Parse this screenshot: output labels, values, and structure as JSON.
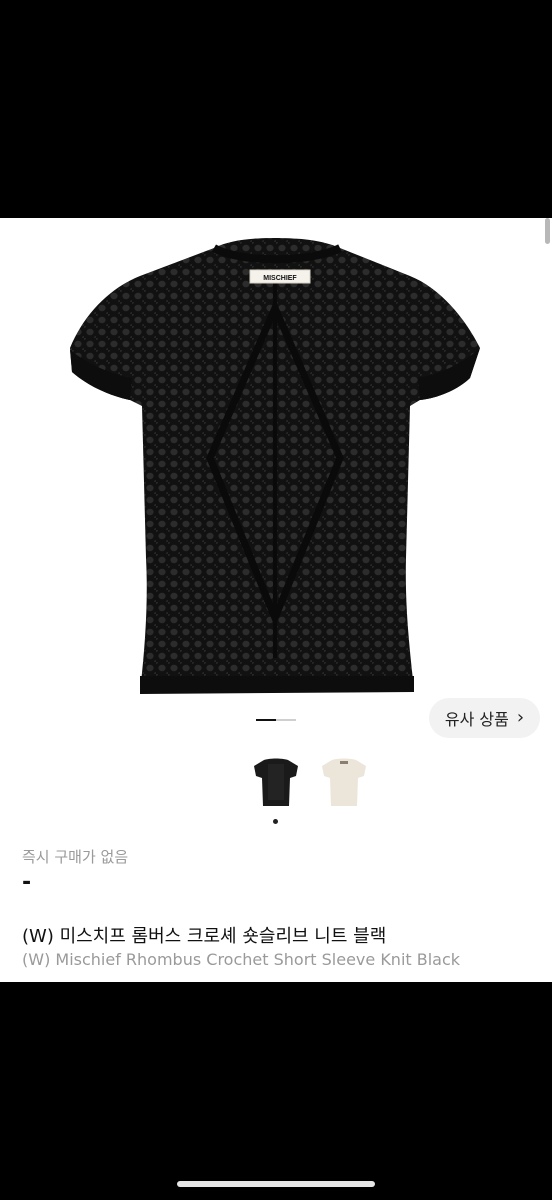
{
  "product": {
    "brand_tag": "MISCHIEF",
    "purchase_status": "즉시 구매가 없음",
    "price": "-",
    "title_ko": "(W) 미스치프 롬버스 크로셰 숏슬리브 니트 블랙",
    "title_en": "(W) Mischief Rhombus Crochet Short Sleeve Knit Black"
  },
  "similar_products": {
    "label": "유사 상품",
    "icon": "chevron-right-icon"
  },
  "gallery": {
    "current_index": 1,
    "total": 2,
    "thumbnails": [
      {
        "color_name": "black",
        "color": "#1a1a1a",
        "selected": true
      },
      {
        "color_name": "cream",
        "color": "#ece6da",
        "selected": false
      }
    ]
  },
  "colors": {
    "background": "#ffffff",
    "frame": "#000000",
    "muted_text": "#9a9a9a",
    "chip_bg": "#f2f2f2"
  }
}
